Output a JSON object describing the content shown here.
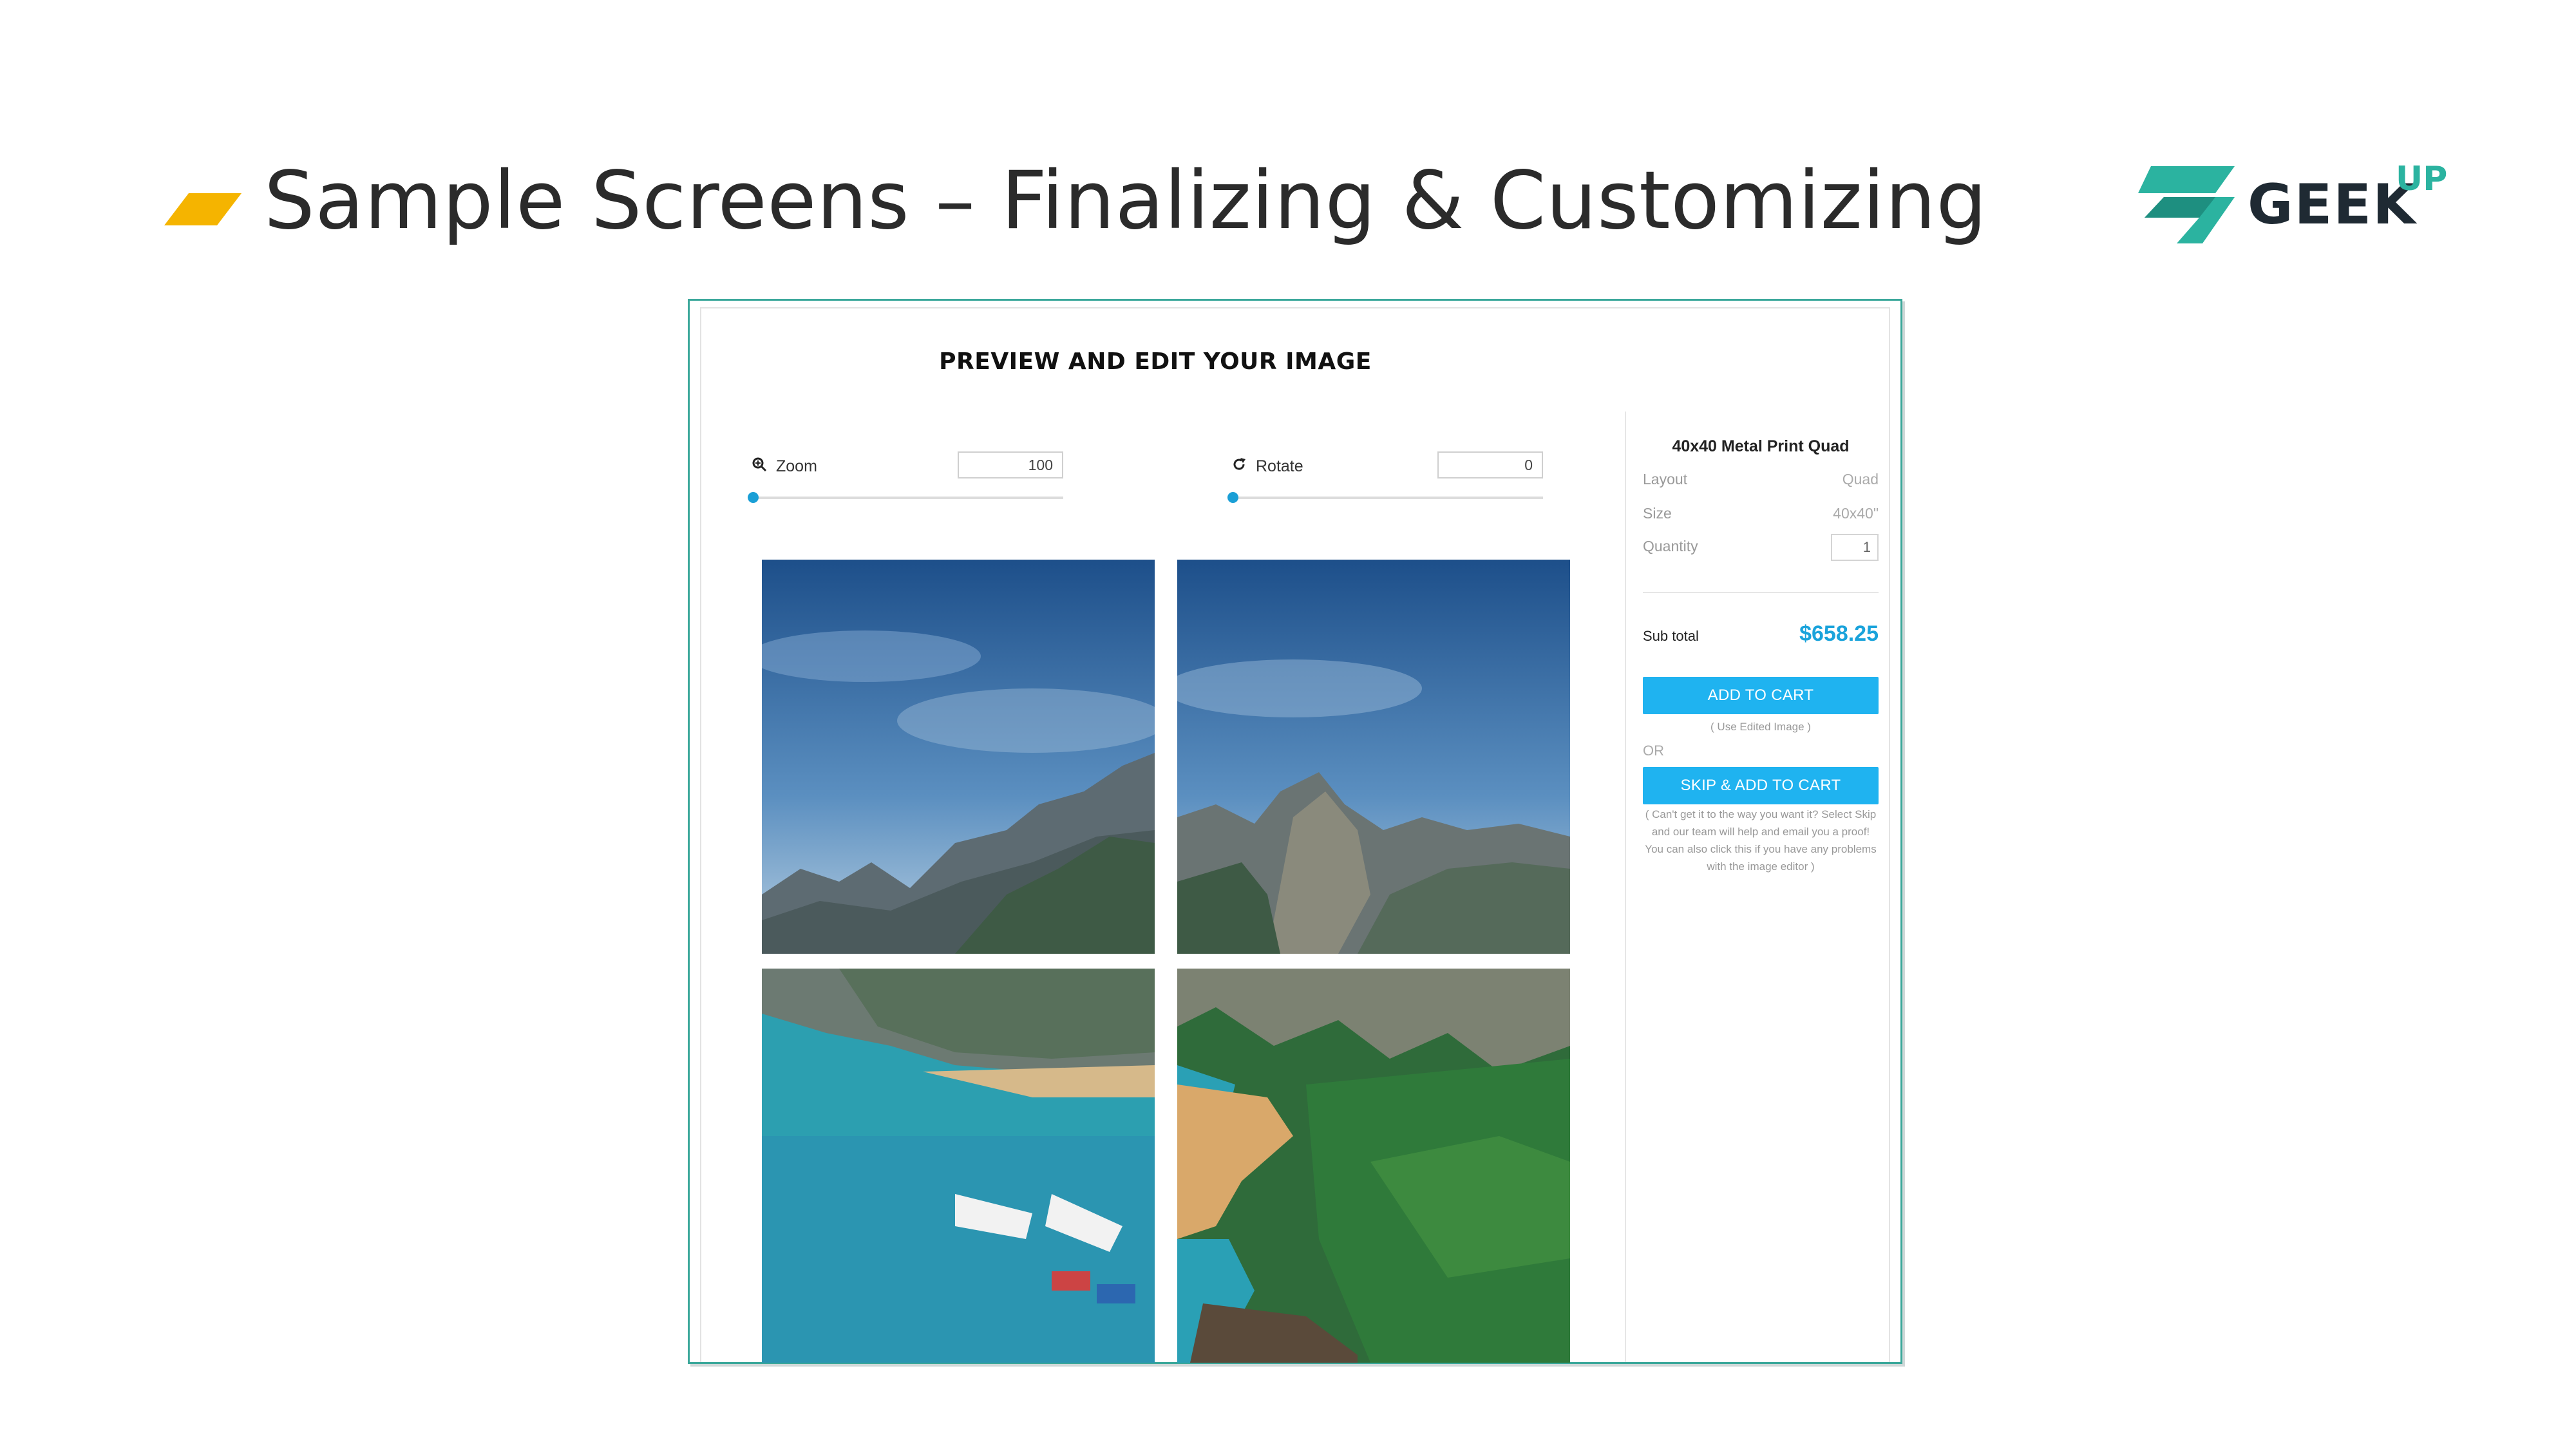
{
  "slide": {
    "title": "Sample Screens – Finalizing & Customizing",
    "logo_text": "GEEK",
    "logo_sup": "UP",
    "accent_color": "#f5b400",
    "logo_colors": [
      "#2bb3a0",
      "#1f2a33"
    ]
  },
  "editor": {
    "title": "PREVIEW AND EDIT YOUR IMAGE",
    "zoom": {
      "label": "Zoom",
      "value": "100",
      "icon": "zoom-icon"
    },
    "rotate": {
      "label": "Rotate",
      "value": "0",
      "icon": "rotate-icon"
    }
  },
  "sidebar": {
    "product_title": "40x40 Metal Print Quad",
    "layout_label": "Layout",
    "layout_value": "Quad",
    "size_label": "Size",
    "size_value": "40x40\"",
    "quantity_label": "Quantity",
    "quantity_value": "1",
    "subtotal_label": "Sub total",
    "subtotal_value": "$658.25",
    "add_to_cart_label": "ADD TO CART",
    "edited_note": "( Use Edited Image )",
    "or_label": "OR",
    "skip_label": "SKIP & ADD TO CART",
    "skip_note": "( Can't get it to the way you want it? Select Skip and our team will help and email you a proof! You can also click this if you have any problems with the image editor )",
    "accent_color": "#1fb3f0"
  }
}
